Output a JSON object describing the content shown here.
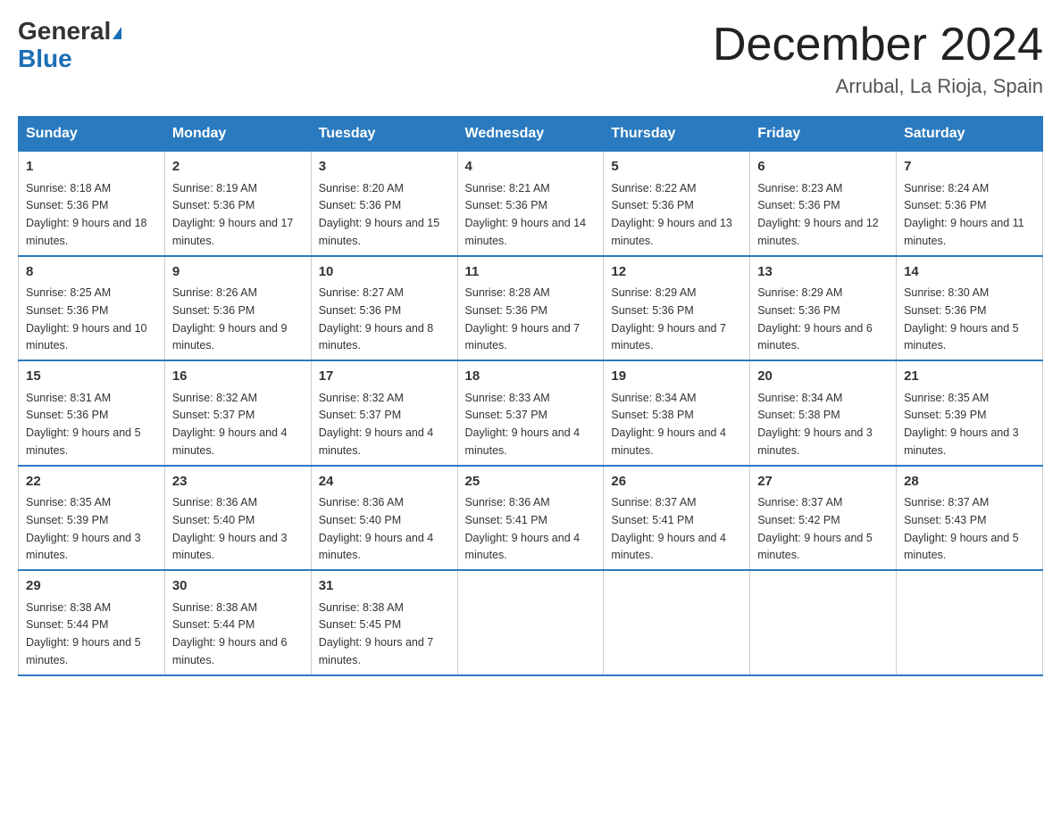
{
  "logo": {
    "general": "General",
    "blue": "Blue"
  },
  "title": "December 2024",
  "location": "Arrubal, La Rioja, Spain",
  "days_of_week": [
    "Sunday",
    "Monday",
    "Tuesday",
    "Wednesday",
    "Thursday",
    "Friday",
    "Saturday"
  ],
  "weeks": [
    [
      {
        "day": "1",
        "sunrise": "8:18 AM",
        "sunset": "5:36 PM",
        "daylight": "9 hours and 18 minutes."
      },
      {
        "day": "2",
        "sunrise": "8:19 AM",
        "sunset": "5:36 PM",
        "daylight": "9 hours and 17 minutes."
      },
      {
        "day": "3",
        "sunrise": "8:20 AM",
        "sunset": "5:36 PM",
        "daylight": "9 hours and 15 minutes."
      },
      {
        "day": "4",
        "sunrise": "8:21 AM",
        "sunset": "5:36 PM",
        "daylight": "9 hours and 14 minutes."
      },
      {
        "day": "5",
        "sunrise": "8:22 AM",
        "sunset": "5:36 PM",
        "daylight": "9 hours and 13 minutes."
      },
      {
        "day": "6",
        "sunrise": "8:23 AM",
        "sunset": "5:36 PM",
        "daylight": "9 hours and 12 minutes."
      },
      {
        "day": "7",
        "sunrise": "8:24 AM",
        "sunset": "5:36 PM",
        "daylight": "9 hours and 11 minutes."
      }
    ],
    [
      {
        "day": "8",
        "sunrise": "8:25 AM",
        "sunset": "5:36 PM",
        "daylight": "9 hours and 10 minutes."
      },
      {
        "day": "9",
        "sunrise": "8:26 AM",
        "sunset": "5:36 PM",
        "daylight": "9 hours and 9 minutes."
      },
      {
        "day": "10",
        "sunrise": "8:27 AM",
        "sunset": "5:36 PM",
        "daylight": "9 hours and 8 minutes."
      },
      {
        "day": "11",
        "sunrise": "8:28 AM",
        "sunset": "5:36 PM",
        "daylight": "9 hours and 7 minutes."
      },
      {
        "day": "12",
        "sunrise": "8:29 AM",
        "sunset": "5:36 PM",
        "daylight": "9 hours and 7 minutes."
      },
      {
        "day": "13",
        "sunrise": "8:29 AM",
        "sunset": "5:36 PM",
        "daylight": "9 hours and 6 minutes."
      },
      {
        "day": "14",
        "sunrise": "8:30 AM",
        "sunset": "5:36 PM",
        "daylight": "9 hours and 5 minutes."
      }
    ],
    [
      {
        "day": "15",
        "sunrise": "8:31 AM",
        "sunset": "5:36 PM",
        "daylight": "9 hours and 5 minutes."
      },
      {
        "day": "16",
        "sunrise": "8:32 AM",
        "sunset": "5:37 PM",
        "daylight": "9 hours and 4 minutes."
      },
      {
        "day": "17",
        "sunrise": "8:32 AM",
        "sunset": "5:37 PM",
        "daylight": "9 hours and 4 minutes."
      },
      {
        "day": "18",
        "sunrise": "8:33 AM",
        "sunset": "5:37 PM",
        "daylight": "9 hours and 4 minutes."
      },
      {
        "day": "19",
        "sunrise": "8:34 AM",
        "sunset": "5:38 PM",
        "daylight": "9 hours and 4 minutes."
      },
      {
        "day": "20",
        "sunrise": "8:34 AM",
        "sunset": "5:38 PM",
        "daylight": "9 hours and 3 minutes."
      },
      {
        "day": "21",
        "sunrise": "8:35 AM",
        "sunset": "5:39 PM",
        "daylight": "9 hours and 3 minutes."
      }
    ],
    [
      {
        "day": "22",
        "sunrise": "8:35 AM",
        "sunset": "5:39 PM",
        "daylight": "9 hours and 3 minutes."
      },
      {
        "day": "23",
        "sunrise": "8:36 AM",
        "sunset": "5:40 PM",
        "daylight": "9 hours and 3 minutes."
      },
      {
        "day": "24",
        "sunrise": "8:36 AM",
        "sunset": "5:40 PM",
        "daylight": "9 hours and 4 minutes."
      },
      {
        "day": "25",
        "sunrise": "8:36 AM",
        "sunset": "5:41 PM",
        "daylight": "9 hours and 4 minutes."
      },
      {
        "day": "26",
        "sunrise": "8:37 AM",
        "sunset": "5:41 PM",
        "daylight": "9 hours and 4 minutes."
      },
      {
        "day": "27",
        "sunrise": "8:37 AM",
        "sunset": "5:42 PM",
        "daylight": "9 hours and 5 minutes."
      },
      {
        "day": "28",
        "sunrise": "8:37 AM",
        "sunset": "5:43 PM",
        "daylight": "9 hours and 5 minutes."
      }
    ],
    [
      {
        "day": "29",
        "sunrise": "8:38 AM",
        "sunset": "5:44 PM",
        "daylight": "9 hours and 5 minutes."
      },
      {
        "day": "30",
        "sunrise": "8:38 AM",
        "sunset": "5:44 PM",
        "daylight": "9 hours and 6 minutes."
      },
      {
        "day": "31",
        "sunrise": "8:38 AM",
        "sunset": "5:45 PM",
        "daylight": "9 hours and 7 minutes."
      },
      null,
      null,
      null,
      null
    ]
  ]
}
